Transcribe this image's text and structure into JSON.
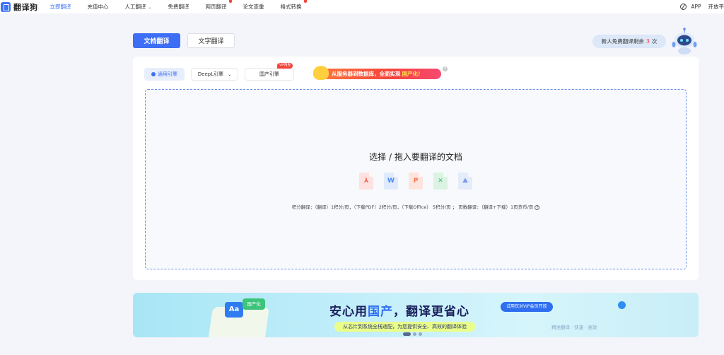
{
  "nav": {
    "logo_text": "翻译狗",
    "items": [
      {
        "label": "立即翻译",
        "active": true
      },
      {
        "label": "充值中心"
      },
      {
        "label": "人工翻译",
        "dropdown": true
      },
      {
        "label": "免费翻译"
      },
      {
        "label": "网页翻译"
      },
      {
        "label": "论文查重"
      },
      {
        "label": "格式转换"
      }
    ],
    "right_app": "APP",
    "right_open": "开放平"
  },
  "tabs": {
    "doc": "文档翻译",
    "text": "文字翻译"
  },
  "free_pill": {
    "prefix": "新人免费翻译剩余",
    "count": "3",
    "suffix": "次"
  },
  "engines": {
    "general": "通用引擎",
    "deepl": "DeepL引擎",
    "domestic": "国产引擎",
    "vip_badge": "VIP限免"
  },
  "promo": {
    "text": "从服务器到数据库，全面实现",
    "highlight": "国产化！"
  },
  "dropzone": {
    "title": "选择 / 拖入要翻译的文档",
    "file_types": [
      "pdf",
      "word",
      "ppt",
      "excel",
      "image"
    ],
    "pricing": "积分翻译：（翻译）1积分/页，（下载PDF）2积分/页，（下载Office） 5积分/页 ； 页数翻译：（翻译+下载）1页货币/页"
  },
  "ad": {
    "aa": "Aa",
    "guo": "国产化",
    "title_a": "安心用",
    "title_hl": "国产",
    "title_b": "，翻译更省心",
    "trial": "试用仅对VIP会员开放",
    "sub": "从芯片到系统全栈适配，为您提供安全、高效的翻译体验",
    "tags": "精准翻译 · 快速 · 高效"
  },
  "colors": {
    "primary": "#3d6ef5",
    "accent_red": "#f5443b"
  }
}
